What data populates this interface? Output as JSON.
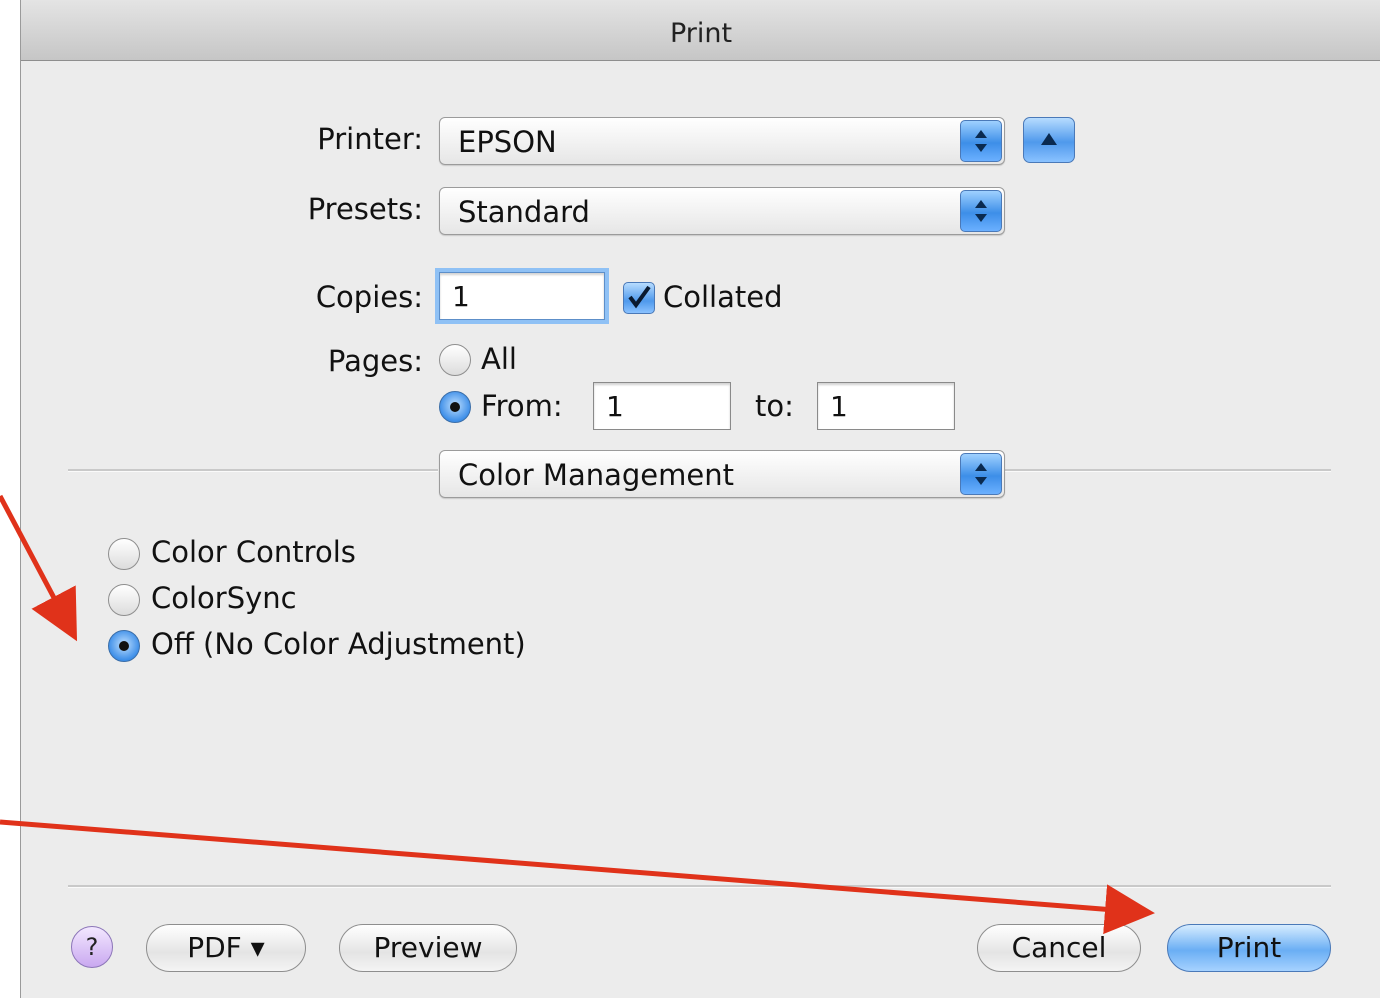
{
  "window": {
    "title": "Print"
  },
  "printer": {
    "label": "Printer:",
    "value": "EPSON"
  },
  "presets": {
    "label": "Presets:",
    "value": "Standard"
  },
  "copies": {
    "label": "Copies:",
    "value": "1",
    "collated_label": "Collated",
    "collated_checked": true
  },
  "pages": {
    "label": "Pages:",
    "all_label": "All",
    "from_label": "From:",
    "from_value": "1",
    "to_label": "to:",
    "to_value": "1",
    "selected": "from"
  },
  "section_popup": {
    "value": "Color Management"
  },
  "color_options": {
    "items": [
      "Color Controls",
      "ColorSync",
      "Off (No Color Adjustment)"
    ],
    "selected_index": 2
  },
  "footer": {
    "help_label": "?",
    "pdf_label": "PDF ▾",
    "preview_label": "Preview",
    "cancel_label": "Cancel",
    "print_label": "Print"
  },
  "colors": {
    "annotation_arrow": "#e0321a",
    "accent_blue": "#3d8ee8"
  }
}
